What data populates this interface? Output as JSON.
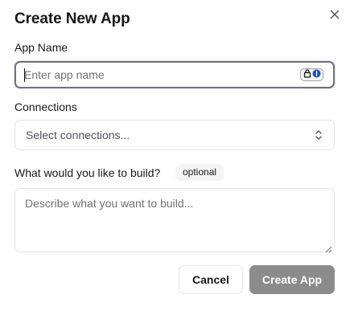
{
  "dialog": {
    "title": "Create New App",
    "close_icon": "close-icon"
  },
  "app_name": {
    "label": "App Name",
    "value": "",
    "placeholder": "Enter app name",
    "badge_icons": [
      "lock-icon",
      "info-icon"
    ]
  },
  "connections": {
    "label": "Connections",
    "placeholder": "Select connections...",
    "icon": "chevron-up-down-icon"
  },
  "build": {
    "label": "What would you like to build?",
    "badge": "optional",
    "value": "",
    "placeholder": "Describe what you want to build..."
  },
  "actions": {
    "cancel_label": "Cancel",
    "create_label": "Create App"
  },
  "colors": {
    "primary_disabled": "#8b8b8b",
    "border": "#e4e4e7",
    "focus_border": "#71717a",
    "badge_bg": "#f4f4f5"
  }
}
